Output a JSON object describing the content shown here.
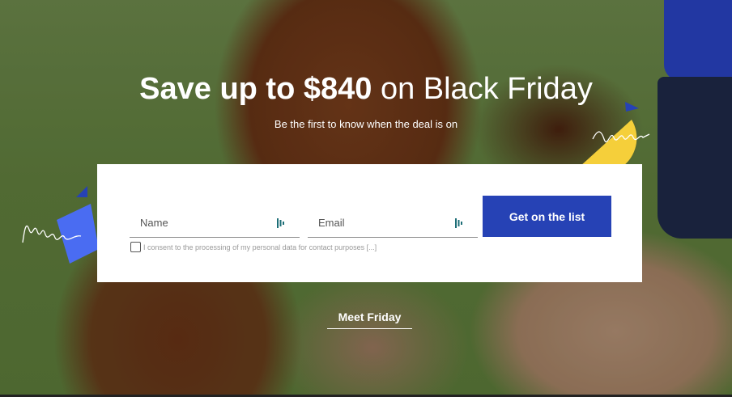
{
  "hero": {
    "headline_strong": "Save up to $840",
    "headline_rest": " on Black Friday",
    "subheadline": "Be the first to know when the deal is on"
  },
  "form": {
    "name_placeholder": "Name",
    "email_placeholder": "Email",
    "submit_label": "Get on the list",
    "consent_label": "I consent to the processing of my personal data for contact purposes [...]",
    "consent_checked": false
  },
  "link": {
    "meet_label": "Meet Friday"
  },
  "colors": {
    "accent_blue": "#2642b5",
    "deco_yellow": "#f5cf3a",
    "deco_blue": "#4a6cf2"
  },
  "icons": {
    "field_icon": "password-manager-icon"
  }
}
